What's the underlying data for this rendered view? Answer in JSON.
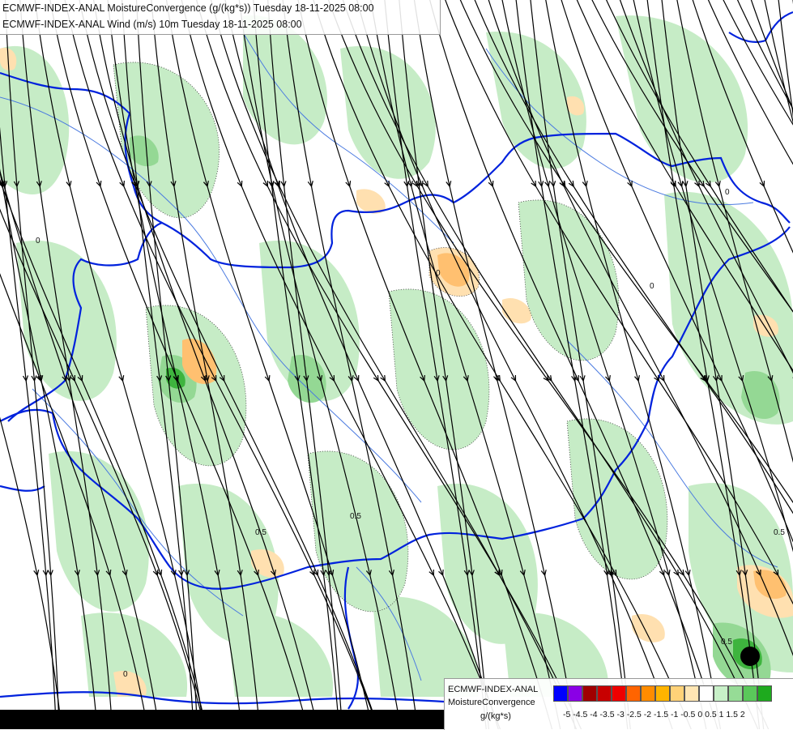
{
  "header": {
    "line1": "ECMWF-INDEX-ANAL MoistureConvergence (g/(kg*s)) Tuesday 18-11-2025 08:00",
    "line2": "ECMWF-INDEX-ANAL Wind (m/s) 10m Tuesday 18-11-2025 08:00"
  },
  "legend": {
    "title_line1": "ECMWF-INDEX-ANAL",
    "title_line2": "MoistureConvergence",
    "unit": "g/(kg*s)",
    "ticks": "-5 -4.5 -4 -3.5 -3 -2.5 -2 -1.5 -1 -0.5  0  0.5  1  1.5  2",
    "colors": [
      "#0000ff",
      "#8a00e6",
      "#a00000",
      "#c80000",
      "#ee0000",
      "#ff6400",
      "#ff8c00",
      "#ffb400",
      "#ffd278",
      "#ffe6b4",
      "#ffffff",
      "#c8f0c8",
      "#96dc96",
      "#5ac85a",
      "#1eaa1e"
    ]
  },
  "map_labels": [
    "0",
    "0",
    "0",
    "0",
    "0",
    "0.5",
    "0.5",
    "0.5",
    "0.5"
  ],
  "colors": {
    "border": "#0022dd",
    "river": "#4a7ae0",
    "green_light": "#c6ecc6",
    "green_mid": "#94d894",
    "green_dark": "#3eb43e",
    "orange_light": "#ffe0b0",
    "orange_mid": "#ffc070",
    "black": "#000000"
  }
}
